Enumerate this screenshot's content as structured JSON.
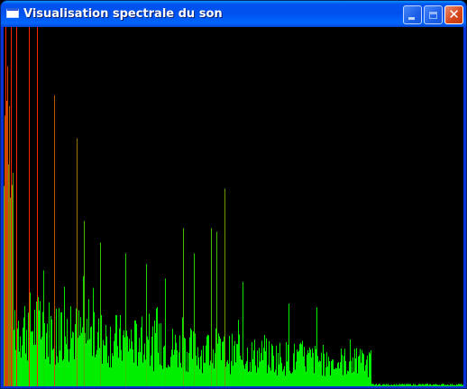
{
  "window": {
    "title": "Visualisation spectrale du son",
    "controls": [
      "minimize",
      "maximize",
      "close"
    ]
  },
  "icons": {
    "app": "window-icon",
    "minimize": "minimize-icon",
    "maximize": "maximize-icon",
    "close": "close-icon",
    "close_glyph": "✕"
  },
  "colors": {
    "background": "#000000",
    "low_level": "#00ee00",
    "high_level": "#ff0000",
    "title_bar": "#0054e3"
  },
  "chart_data": {
    "type": "bar",
    "title": "",
    "xlabel": "",
    "ylabel": "",
    "ylim": [
      0,
      1
    ],
    "color_scale": "green (low) to red (high)",
    "peaks": [
      {
        "x": 0.004,
        "y": 1.0
      },
      {
        "x": 0.015,
        "y": 1.0
      },
      {
        "x": 0.027,
        "y": 1.0
      },
      {
        "x": 0.055,
        "y": 1.0
      },
      {
        "x": 0.072,
        "y": 1.0
      },
      {
        "x": 0.11,
        "y": 0.81
      },
      {
        "x": 0.158,
        "y": 0.69
      },
      {
        "x": 0.175,
        "y": 0.46
      },
      {
        "x": 0.21,
        "y": 0.4
      },
      {
        "x": 0.265,
        "y": 0.37
      },
      {
        "x": 0.39,
        "y": 0.44
      },
      {
        "x": 0.45,
        "y": 0.44
      },
      {
        "x": 0.48,
        "y": 0.55
      },
      {
        "x": 0.414,
        "y": 0.37
      },
      {
        "x": 0.462,
        "y": 0.43
      },
      {
        "x": 0.31,
        "y": 0.34
      },
      {
        "x": 0.35,
        "y": 0.3
      },
      {
        "x": 0.52,
        "y": 0.29
      },
      {
        "x": 0.62,
        "y": 0.23
      },
      {
        "x": 0.68,
        "y": 0.22
      }
    ],
    "cutoff": 0.8,
    "tail_level": 0.005
  }
}
